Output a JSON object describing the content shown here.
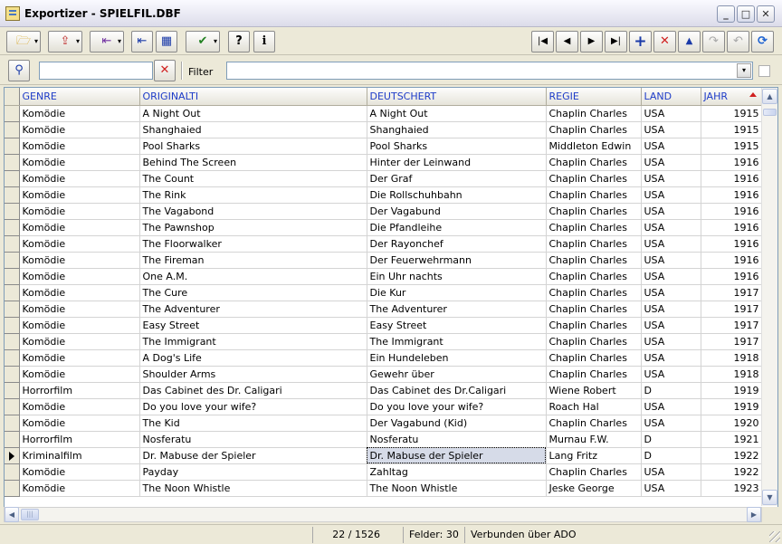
{
  "window": {
    "title": "Exportizer - SPIELFIL.DBF"
  },
  "window_buttons": {
    "minimize": "_",
    "maximize": "□",
    "close": "✕"
  },
  "toolbar": {
    "open": "🗁",
    "export": "⇪",
    "import": "⇤",
    "filter": "✔",
    "help": "?",
    "info": "i",
    "dropdown": "▾",
    "nav_first": "|◀",
    "nav_prior": "◀",
    "nav_next": "▶",
    "nav_last": "▶|",
    "nav_insert": "+",
    "nav_delete": "✕",
    "nav_edit": "▲",
    "nav_post": "↷",
    "nav_cancel": "↶",
    "nav_refresh": "⟳"
  },
  "filterbar": {
    "search_value": "",
    "filter_label": "Filter",
    "filter_value": "",
    "combo_arrow": "▾"
  },
  "grid": {
    "columns": [
      "GENRE",
      "ORIGINALTI",
      "DEUTSCHERT",
      "REGIE",
      "LAND",
      "JAHR"
    ],
    "sort_column": "JAHR",
    "current_row": 21,
    "rows": [
      [
        "Komödie",
        "A Night Out",
        "A Night Out",
        "Chaplin Charles",
        "USA",
        "1915"
      ],
      [
        "Komödie",
        "Shanghaied",
        "Shanghaied",
        "Chaplin Charles",
        "USA",
        "1915"
      ],
      [
        "Komödie",
        "Pool Sharks",
        "Pool Sharks",
        "Middleton Edwin",
        "USA",
        "1915"
      ],
      [
        "Komödie",
        "Behind The Screen",
        "Hinter der Leinwand",
        "Chaplin Charles",
        "USA",
        "1916"
      ],
      [
        "Komödie",
        "The Count",
        "Der Graf",
        "Chaplin Charles",
        "USA",
        "1916"
      ],
      [
        "Komödie",
        "The Rink",
        "Die Rollschuhbahn",
        "Chaplin Charles",
        "USA",
        "1916"
      ],
      [
        "Komödie",
        "The Vagabond",
        "Der Vagabund",
        "Chaplin Charles",
        "USA",
        "1916"
      ],
      [
        "Komödie",
        "The Pawnshop",
        "Die Pfandleihe",
        "Chaplin Charles",
        "USA",
        "1916"
      ],
      [
        "Komödie",
        "The Floorwalker",
        "Der Rayonchef",
        "Chaplin Charles",
        "USA",
        "1916"
      ],
      [
        "Komödie",
        "The Fireman",
        "Der Feuerwehrmann",
        "Chaplin Charles",
        "USA",
        "1916"
      ],
      [
        "Komödie",
        "One A.M.",
        "Ein Uhr nachts",
        "Chaplin Charles",
        "USA",
        "1916"
      ],
      [
        "Komödie",
        "The Cure",
        "Die Kur",
        "Chaplin Charles",
        "USA",
        "1917"
      ],
      [
        "Komödie",
        "The Adventurer",
        "The Adventurer",
        "Chaplin Charles",
        "USA",
        "1917"
      ],
      [
        "Komödie",
        "Easy Street",
        "Easy Street",
        "Chaplin Charles",
        "USA",
        "1917"
      ],
      [
        "Komödie",
        "The Immigrant",
        "The Immigrant",
        "Chaplin Charles",
        "USA",
        "1917"
      ],
      [
        "Komödie",
        "A Dog's Life",
        "Ein Hundeleben",
        "Chaplin Charles",
        "USA",
        "1918"
      ],
      [
        "Komödie",
        "Shoulder Arms",
        "Gewehr über",
        "Chaplin Charles",
        "USA",
        "1918"
      ],
      [
        "Horrorfilm",
        "Das Cabinet des Dr. Caligari",
        "Das Cabinet des Dr.Caligari",
        "Wiene Robert",
        "D",
        "1919"
      ],
      [
        "Komödie",
        "Do you love your wife?",
        "Do you love your wife?",
        "Roach Hal",
        "USA",
        "1919"
      ],
      [
        "Komödie",
        "The Kid",
        "Der Vagabund (Kid)",
        "Chaplin Charles",
        "USA",
        "1920"
      ],
      [
        "Horrorfilm",
        "Nosferatu",
        "Nosferatu",
        "Murnau F.W.",
        "D",
        "1921"
      ],
      [
        "Kriminalfilm",
        "Dr. Mabuse der Spieler",
        "Dr. Mabuse der Spieler",
        "Lang Fritz",
        "D",
        "1922"
      ],
      [
        "Komödie",
        "Payday",
        "Zahltag",
        "Chaplin Charles",
        "USA",
        "1922"
      ],
      [
        "Komödie",
        "The Noon Whistle",
        "The Noon Whistle",
        "Jeske George",
        "USA",
        "1923"
      ]
    ]
  },
  "statusbar": {
    "position": "22 / 1526",
    "fields": "Felder: 30",
    "connection": "Verbunden über ADO"
  }
}
